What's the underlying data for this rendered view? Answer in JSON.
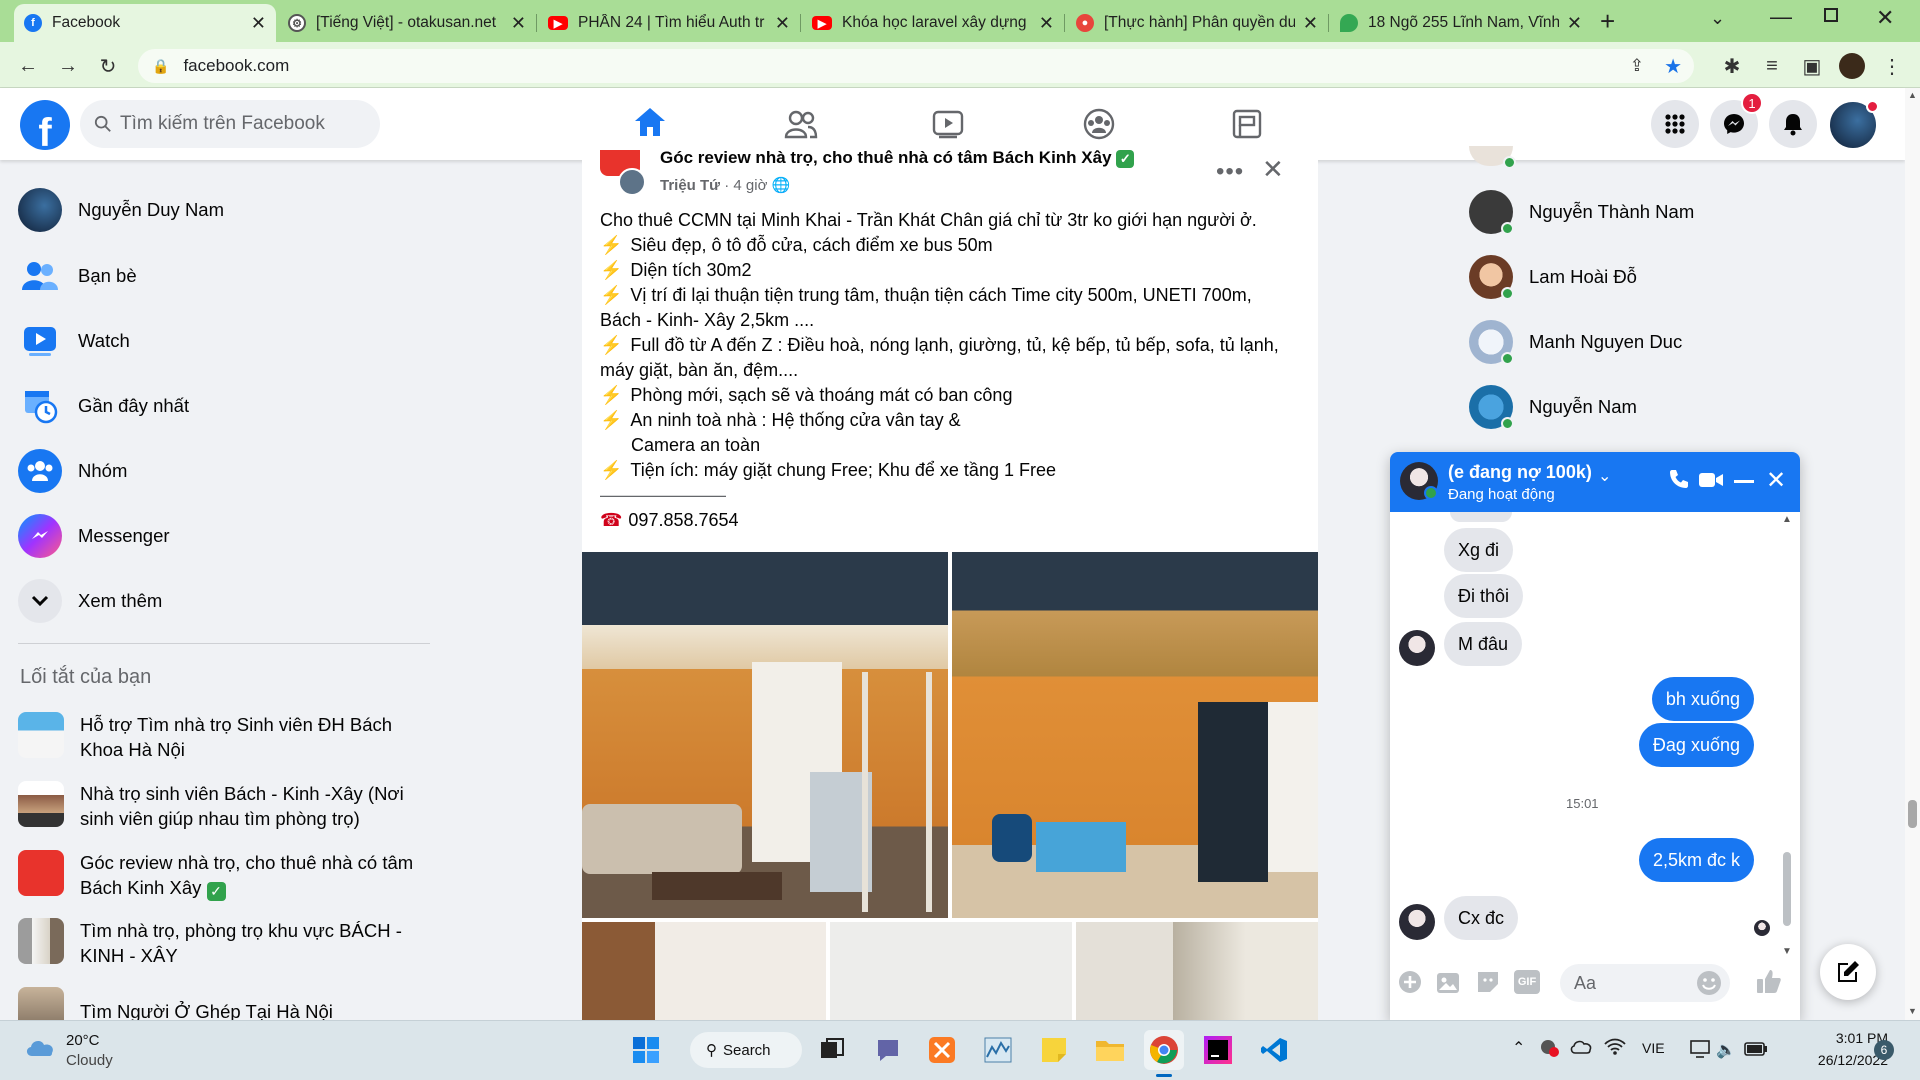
{
  "browser": {
    "tabs": [
      {
        "title": "Facebook",
        "icon": "facebook-icon",
        "color": "#1877f2"
      },
      {
        "title": "[Tiếng Việt] - otakusan.net",
        "icon": "gear-icon",
        "color": "#555555"
      },
      {
        "title": "PHẦN 24 | Tìm hiểu Auth tr",
        "icon": "youtube-icon",
        "color": "#ff0000"
      },
      {
        "title": "Khóa học laravel xây dựng",
        "icon": "youtube-icon",
        "color": "#ff0000"
      },
      {
        "title": "[Thực hành] Phân quyền dư",
        "icon": "site-icon",
        "color": "#e8453c"
      },
      {
        "title": "18 Ngõ 255 Lĩnh Nam, Vĩnh",
        "icon": "maps-icon",
        "color": "#34a853"
      }
    ],
    "url": "facebook.com"
  },
  "header": {
    "search_placeholder": "Tìm kiếm trên Facebook",
    "messenger_badge": "1"
  },
  "sidebar": {
    "items": [
      {
        "label": "Nguyễn Duy Nam",
        "icon": "profile-avatar"
      },
      {
        "label": "Bạn bè",
        "icon": "friends-icon"
      },
      {
        "label": "Watch",
        "icon": "watch-icon"
      },
      {
        "label": "Gần đây nhất",
        "icon": "recent-icon"
      },
      {
        "label": "Nhóm",
        "icon": "groups-icon"
      },
      {
        "label": "Messenger",
        "icon": "messenger-icon"
      },
      {
        "label": "Xem thêm",
        "icon": "chevron-down-icon"
      }
    ],
    "shortcuts_title": "Lối tắt của bạn",
    "shortcuts": [
      {
        "line1": "Hỗ trợ Tìm nhà trọ Sinh viên ĐH Bách",
        "line2": "Khoa Hà Nội"
      },
      {
        "line1": "Nhà trọ sinh viên Bách - Kinh -Xây (Nơi",
        "line2": "sinh viên giúp nhau tìm phòng trọ)"
      },
      {
        "line1": "Góc review nhà trọ, cho thuê nhà có tâm",
        "line2": "Bách Kinh Xây"
      },
      {
        "line1": "Tìm nhà trọ, phòng trọ khu vực BÁCH -",
        "line2": "KINH - XÂY"
      },
      {
        "line1": "Tìm Người Ở Ghép Tại Hà Nội",
        "line2": ""
      }
    ]
  },
  "post": {
    "group": "Góc review nhà trọ, cho thuê nhà có tâm Bách Kinh Xây",
    "author": "Triệu Tứ",
    "time": "4 giờ",
    "lines": [
      "Cho thuê CCMN tại Minh Khai - Trần Khát Chân giá chỉ từ 3tr ko giới hạn người ở.",
      "Siêu đẹp, ô tô đỗ cửa, cách điểm xe bus 50m",
      "Diện tích 30m2",
      "Vị trí đi lại thuận tiện trung tâm, thuận tiện cách Time city 500m, UNETI 700m,",
      "Bách - Kinh- Xây 2,5km ....",
      "Full đồ từ A đến Z : Điều hoà, nóng lạnh, giường, tủ, kệ bếp, tủ bếp, sofa, tủ lạnh,",
      "máy giặt, bàn ăn, đệm....",
      "Phòng mới, sạch sẽ và thoáng mát có ban công",
      "An ninh toà nhà : Hệ thống cửa vân tay &",
      "Camera an toàn",
      "Tiện ích: máy giặt chung Free; Khu để xe tầng 1 Free",
      "———————",
      "097.858.7654"
    ]
  },
  "contacts": [
    {
      "name": "Nguyễn Thành Nam"
    },
    {
      "name": "Lam Hoài Đỗ"
    },
    {
      "name": "Manh Nguyen Duc"
    },
    {
      "name": "Nguyễn Nam"
    }
  ],
  "chat": {
    "name": "(e đang nợ 100k)",
    "status": "Đang hoạt động",
    "messages": [
      {
        "text": "Xg đi",
        "dir": "in"
      },
      {
        "text": "Đi thôi",
        "dir": "in"
      },
      {
        "text": "M đâu",
        "dir": "in"
      },
      {
        "text": "bh xuống",
        "dir": "out"
      },
      {
        "text": "Đag xuống",
        "dir": "out"
      },
      {
        "text": "2,5km đc k",
        "dir": "out"
      },
      {
        "text": "Cx đc",
        "dir": "in"
      }
    ],
    "time_sep": "15:01",
    "input_placeholder": "Aa"
  },
  "taskbar": {
    "temp": "20°C",
    "weather": "Cloudy",
    "search": "Search",
    "lang": "VIE",
    "time": "3:01 PM",
    "date": "26/12/2022",
    "notif": "6"
  }
}
